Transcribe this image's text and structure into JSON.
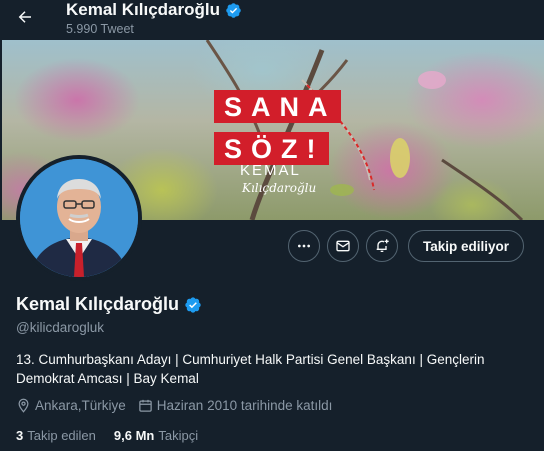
{
  "header": {
    "name": "Kemal Kılıçdaroğlu",
    "tweet_count": "5.990 Tweet"
  },
  "banner": {
    "slogan_line1": "SANA",
    "slogan_line2": "SÖZ!",
    "signature_name": "KEMAL",
    "signature_script": "Kılıçdaroğlu"
  },
  "actions": {
    "more_icon": "more-dots-icon",
    "message_icon": "envelope-icon",
    "notify_icon": "bell-plus-icon",
    "follow_label": "Takip ediliyor"
  },
  "profile": {
    "name": "Kemal Kılıçdaroğlu",
    "handle": "@kilicdarogluk",
    "bio": "13. Cumhurbaşkanı Adayı | Cumhuriyet Halk Partisi Genel Başkanı | Gençlerin Demokrat Amcası | Bay Kemal",
    "location": "Ankara,Türkiye",
    "joined": "Haziran 2010 tarihinde katıldı",
    "following_count": "3",
    "following_label": "Takip edilen",
    "followers_count": "9,6 Mn",
    "followers_label": "Takipçi"
  },
  "colors": {
    "background": "#15202b",
    "verified": "#1d9bf0",
    "muted": "#8b98a5",
    "slogan_red": "#d21e2a"
  }
}
